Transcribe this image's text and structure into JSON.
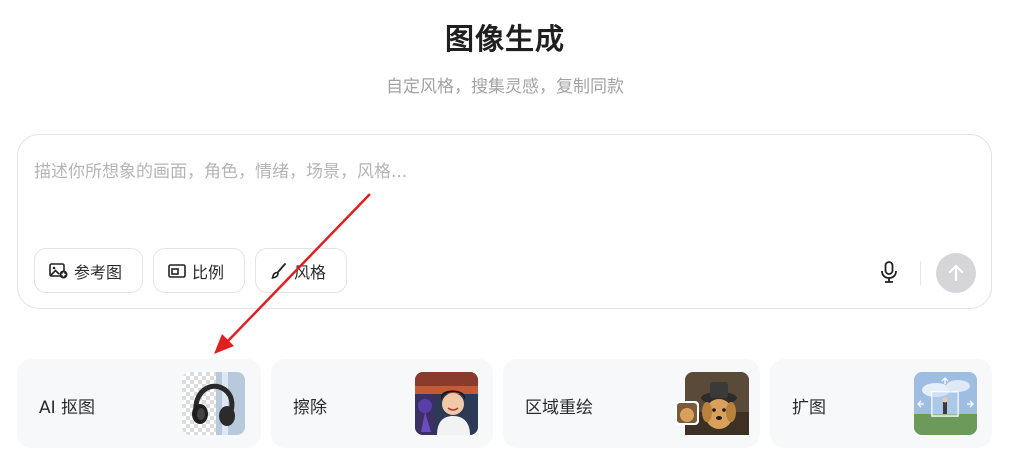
{
  "header": {
    "title": "图像生成",
    "subtitle": "自定风格，搜集灵感，复制同款"
  },
  "prompt": {
    "placeholder": "描述你所想象的画面，角色，情绪，场景，风格...",
    "value": ""
  },
  "chips": [
    {
      "label": "参考图",
      "icon": "image-add-icon"
    },
    {
      "label": "比例",
      "icon": "aspect-ratio-icon"
    },
    {
      "label": "风格",
      "icon": "brush-icon"
    }
  ],
  "actions": {
    "mic_icon": "microphone-icon",
    "send_icon": "arrow-up-icon"
  },
  "tools": [
    {
      "label": "AI 抠图",
      "thumb": "headphones-cutout-thumbnail"
    },
    {
      "label": "擦除",
      "thumb": "girl-portrait-thumbnail"
    },
    {
      "label": "区域重绘",
      "thumb": "dog-with-hat-thumbnail"
    },
    {
      "label": "扩图",
      "thumb": "landscape-expand-thumbnail"
    }
  ],
  "colors": {
    "accent_annotation": "#e02020",
    "send_disabled": "#d6d6d8",
    "card_background": "#f7f8fa"
  }
}
